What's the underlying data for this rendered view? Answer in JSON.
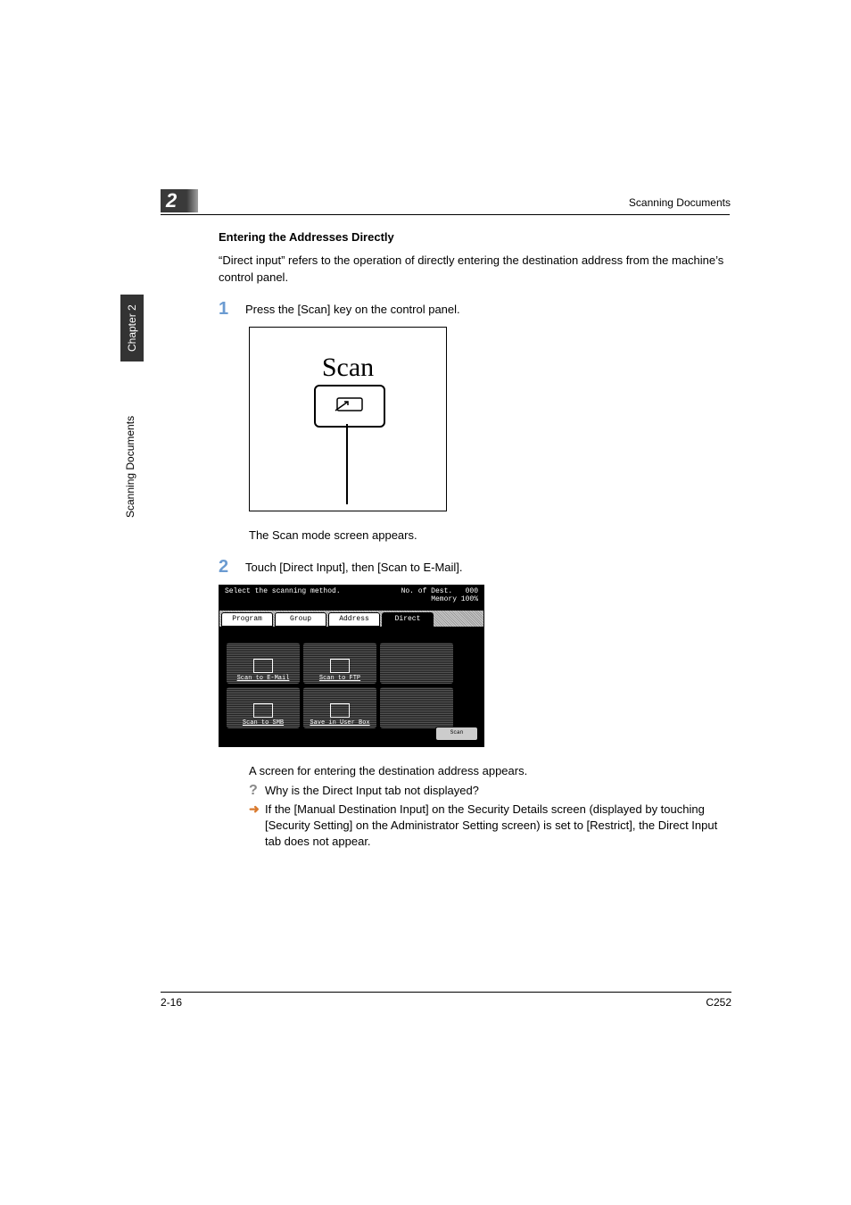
{
  "chapter_num": "2",
  "running_head": "Scanning Documents",
  "sidebar": {
    "tab": "Chapter 2",
    "section": "Scanning Documents"
  },
  "heading": "Entering the Addresses Directly",
  "intro": "“Direct input” refers to the operation of directly entering the destination address from the machine’s control panel.",
  "steps": {
    "s1_num": "1",
    "s1_text": "Press the [Scan] key on the control panel.",
    "scan_label": "Scan",
    "after_fig1": "The Scan mode screen appears.",
    "s2_num": "2",
    "s2_text": "Touch [Direct Input], then [Scan to E-Mail]."
  },
  "screen": {
    "prompt": "Select the scanning method.",
    "dest_label": "No. of Dest.",
    "dest_count": "000",
    "memory": "Memory 100%",
    "tabs": [
      "Program",
      "Group",
      "Address Book",
      "Direct Input"
    ],
    "buttons": {
      "email": "Scan to E-Mail",
      "ftp": "Scan to FTP",
      "smb": "Scan to SMB",
      "userbox": "Save in User Box"
    },
    "settings": "Scan Settings"
  },
  "after_fig2": "A screen for entering the destination address appears.",
  "qa": {
    "q": "Why is the Direct Input tab not displayed?",
    "a": "If the [Manual Destination Input] on the Security Details screen (displayed by touching [Security Setting] on the Administrator Setting screen) is set to [Restrict], the Direct Input tab does not appear."
  },
  "footer": {
    "page": "2-16",
    "model": "C252"
  }
}
